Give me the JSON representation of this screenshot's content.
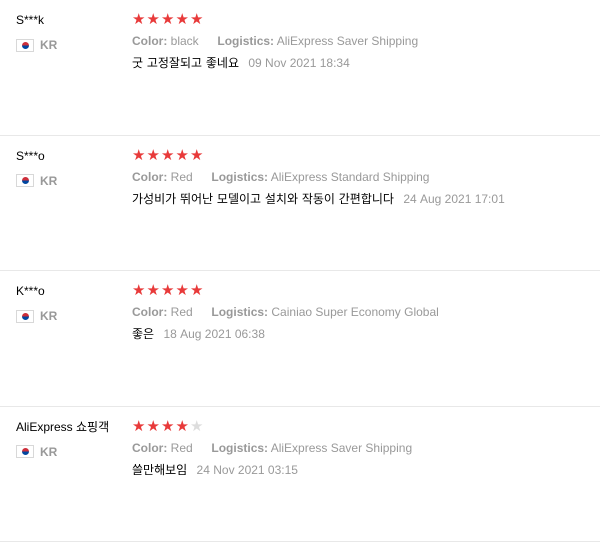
{
  "labels": {
    "color": "Color:",
    "logistics": "Logistics:"
  },
  "reviews": [
    {
      "user": "S***k",
      "country": "KR",
      "rating": 5,
      "stars": "★★★★★",
      "color": "black",
      "logistics": "AliExpress Saver Shipping",
      "text": "굿 고정잘되고 좋네요",
      "date": "09 Nov 2021 18:34"
    },
    {
      "user": "S***o",
      "country": "KR",
      "rating": 5,
      "stars": "★★★★★",
      "color": "Red",
      "logistics": "AliExpress Standard Shipping",
      "text": "가성비가 뛰어난 모델이고 설치와 작동이 간편합니다",
      "date": "24 Aug 2021 17:01"
    },
    {
      "user": "K***o",
      "country": "KR",
      "rating": 5,
      "stars": "★★★★★",
      "color": "Red",
      "logistics": "Cainiao Super Economy Global",
      "text": "좋은",
      "date": "18 Aug 2021 06:38"
    },
    {
      "user": "AliExpress 쇼핑객",
      "country": "KR",
      "rating": 4,
      "stars": "★★★★",
      "color": "Red",
      "logistics": "AliExpress Saver Shipping",
      "text": "쓸만해보임",
      "date": "24 Nov 2021 03:15"
    }
  ],
  "colors": {
    "star_filled": "#e83a3a",
    "star_empty": "#dddddd",
    "muted": "#999999"
  }
}
